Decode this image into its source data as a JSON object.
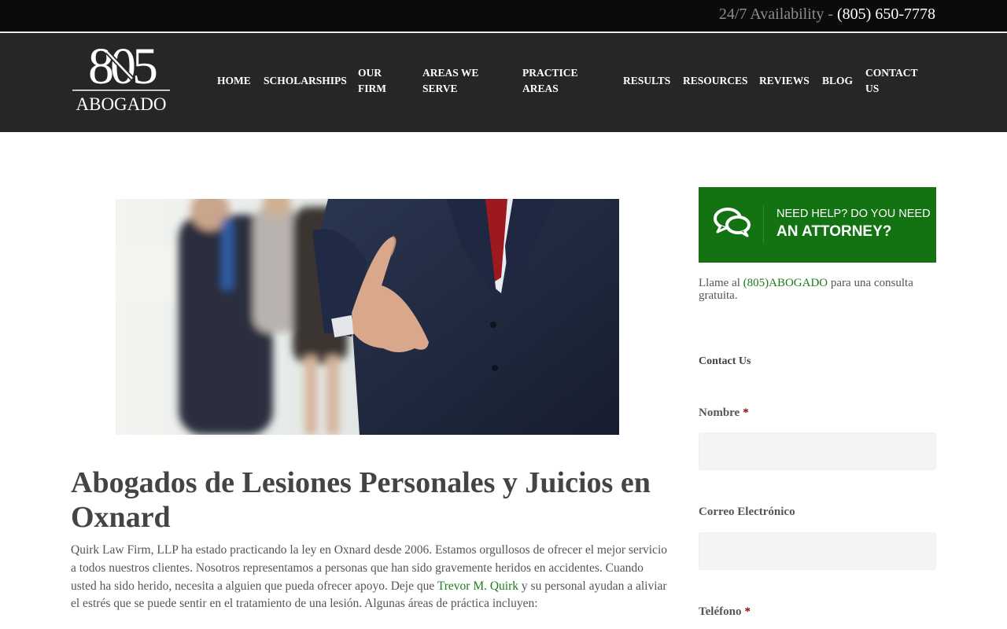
{
  "topbar": {
    "availability": "24/7 Availability - ",
    "phone": "(805) 650-7778"
  },
  "logo": {
    "numerals": "805",
    "word": "ABOGADO"
  },
  "nav": {
    "home": "HOME",
    "scholarships": "SCHOLARSHIPS",
    "our_firm_1": "OUR",
    "our_firm_2": "FIRM",
    "areas_1": "AREAS WE",
    "areas_2": "SERVE",
    "practice_1": "PRACTICE",
    "practice_2": "AREAS",
    "results": "RESULTS",
    "resources": "RESOURCES",
    "reviews": "REVIEWS",
    "blog": "BLOG",
    "contact_1": "CONTACT",
    "contact_2": "US"
  },
  "main": {
    "title": "Abogados de Lesiones Personales y Juicios en Oxnard",
    "intro_before": "Quirk Law Firm, LLP ha estado practicando la ley en Oxnard desde 2006. Estamos orgullosos de ofrecer el mejor servicio a todos nuestros clientes. Nosotros representamos a personas que han sido gravemente heridos en accidentes. Cuando usted ha sido herido, necesita a alguien que pueda ofrecer apoyo. Deje que ",
    "intro_link": "Trevor M. Quirk",
    "intro_after": " y su personal ayudan a aliviar el estrés que se puede sentir en el tratamiento de una lesión. Algunas áreas de práctica incluyen:"
  },
  "sidebar": {
    "banner_line1": "NEED HELP? DO YOU NEED",
    "banner_line2": "AN ATTORNEY?",
    "call_before": "Llame al ",
    "call_link": "(805)ABOGADO",
    "call_after": " para una consulta gratuita.",
    "contact_heading": "Contact Us",
    "field_name": "Nombre",
    "field_email": "Correo Electrónico",
    "field_phone": "Teléfono",
    "required_mark": "*"
  },
  "colors": {
    "topbar": "#0b0b0b",
    "header": "#262626",
    "accent_green": "#137312",
    "link_green": "#1b7a1b"
  }
}
